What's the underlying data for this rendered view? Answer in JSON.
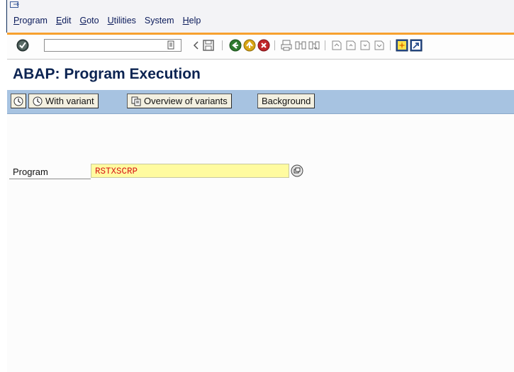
{
  "menu": {
    "items": [
      {
        "label": "Program",
        "accel": "P",
        "rest": "rogram"
      },
      {
        "label": "Edit",
        "accel": "E",
        "rest": "dit"
      },
      {
        "label": "Goto",
        "accel": "G",
        "rest": "oto"
      },
      {
        "label": "Utilities",
        "accel": "U",
        "rest": "tilities"
      },
      {
        "label": "System",
        "accel": "",
        "rest": "System"
      },
      {
        "label": "Help",
        "accel": "H",
        "rest": "elp"
      }
    ]
  },
  "toolbar": {
    "command_field_value": "",
    "icons": [
      "enter-check-icon",
      "command-history-icon",
      "back-arrow-icon",
      "save-icon",
      "back-icon",
      "exit-icon",
      "cancel-icon",
      "print-icon",
      "find-icon",
      "find-next-icon",
      "first-page-icon",
      "previous-page-icon",
      "next-page-icon",
      "last-page-icon",
      "create-session-icon",
      "shortcut-icon"
    ]
  },
  "title": "ABAP: Program Execution",
  "app_toolbar": {
    "execute_icon": "execute-clock-icon",
    "with_variant_label": "With variant",
    "overview_label": "Overview of variants",
    "background_label": "Background"
  },
  "form": {
    "program_label": "Program",
    "program_value": "RSTXSCRP"
  },
  "colors": {
    "menubar_bg": "#f3f3f6",
    "toolbar_accent": "#f7a12f",
    "app_toolbar_bg": "#a7c3e1",
    "title_color": "#0c2452",
    "input_bg": "#fffba0",
    "input_text": "#d71515"
  }
}
